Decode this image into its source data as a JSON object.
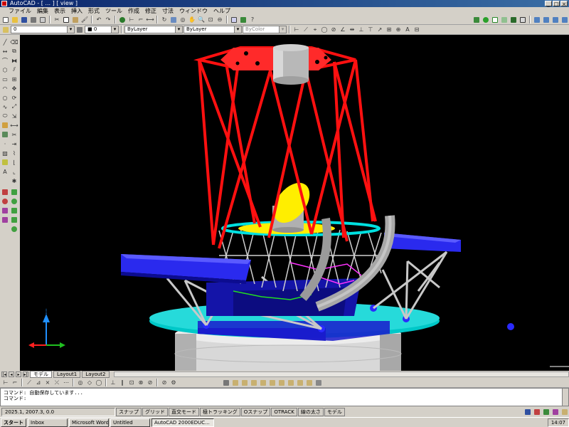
{
  "window": {
    "title": "AutoCAD - [ ... ] [ view ]"
  },
  "menu": [
    "ファイル",
    "編集",
    "表示",
    "挿入",
    "形式",
    "ツール",
    "作成",
    "修正",
    "寸法",
    "ウィンドウ",
    "ヘルプ"
  ],
  "layers_toolbar": {
    "layer_combo": "0",
    "color_combo": "■ 0",
    "linetype_combo": "ByLayer",
    "lineweight_combo": "ByLayer",
    "plotstyle_combo": "ByColor"
  },
  "layout_tabs": {
    "active": "モデル",
    "tabs": [
      "モデル",
      "Layout1",
      "Layout2"
    ]
  },
  "command_line": {
    "lines": [
      "コマンド: 自動保存しています...",
      "コマンド:"
    ]
  },
  "status": {
    "coords": "2025.1, 2007.3, 0.0",
    "modes": [
      "スナップ",
      "グリッド",
      "直交モード",
      "極トラッキング",
      "Oスナップ",
      "OTRACK",
      "線の太さ",
      "モデル"
    ]
  },
  "taskbar": {
    "start": "スタート",
    "tasks": [
      "Inbox",
      "Microsoft Word",
      "Untitled",
      "AutoCAD 2000EDUC..."
    ],
    "active_task": "AutoCAD 2000EDUC...",
    "clock": "14:07"
  },
  "colors": {
    "background": "#000000",
    "top_truss": "#ff1010",
    "secondary_mirror": "#b8b8b8",
    "primary_mirror": "#ffee00",
    "platform": "#1a1acc",
    "base_ring": "#00c8c8",
    "base_cylinder": "#d8d8d8",
    "cradle": "#9a9a9a",
    "lower_struts": "#c8c8c8",
    "ucs_x": "#ff2020",
    "ucs_y": "#20c020",
    "ucs_z": "#2090ff"
  },
  "icons": {
    "left_toolbar": [
      "line-icon",
      "construction-line-icon",
      "polyline-icon",
      "polygon-icon",
      "rectangle-icon",
      "arc-icon",
      "circle-icon",
      "spline-icon",
      "ellipse-icon",
      "insert-block-icon",
      "make-block-icon",
      "point-icon",
      "hatch-icon",
      "region-icon",
      "text-icon",
      "erase-icon",
      "copy-icon",
      "mirror-icon",
      "offset-icon",
      "array-icon",
      "move-icon",
      "rotate-icon",
      "scale-icon",
      "stretch-icon",
      "trim-icon",
      "extend-icon",
      "break-icon",
      "chamfer-icon",
      "fillet-icon",
      "explode-icon"
    ]
  }
}
